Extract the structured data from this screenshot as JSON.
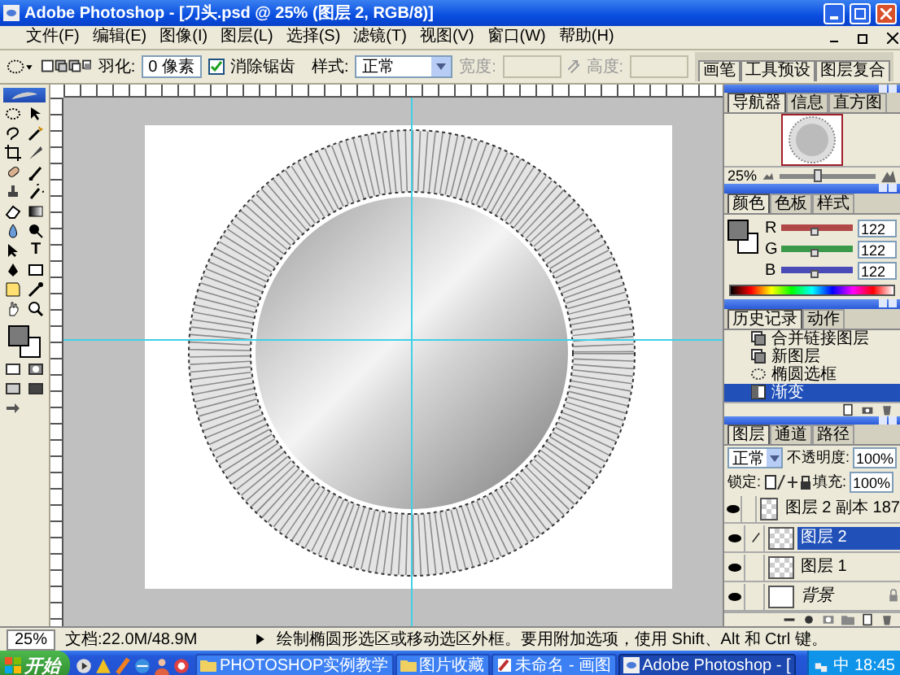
{
  "window": {
    "title": "Adobe Photoshop - [刀头.psd @ 25% (图层 2, RGB/8)]"
  },
  "menu": [
    "文件(F)",
    "编辑(E)",
    "图像(I)",
    "图层(L)",
    "选择(S)",
    "滤镜(T)",
    "视图(V)",
    "窗口(W)",
    "帮助(H)"
  ],
  "options_bar": {
    "feather_label": "羽化:",
    "feather_value": "0 像素",
    "antialias": {
      "label": "消除锯齿",
      "checked": true
    },
    "style_label": "样式:",
    "style_value": "正常",
    "width_label": "宽度:",
    "height_label": "高度:",
    "well_tabs": [
      "画笔",
      "工具预设",
      "图层复合"
    ]
  },
  "toolbox": {
    "type_tool_glyph": "T"
  },
  "navigator": {
    "tabs": [
      {
        "label": "导航器",
        "selected": true
      },
      {
        "label": "信息",
        "selected": false
      },
      {
        "label": "直方图",
        "selected": false
      }
    ],
    "zoom": "25%",
    "slider": {
      "level": 0.4
    }
  },
  "color": {
    "tabs": [
      {
        "label": "颜色",
        "selected": true
      },
      {
        "label": "色板",
        "selected": false
      },
      {
        "label": "样式",
        "selected": false
      }
    ],
    "channels": [
      {
        "name": "R",
        "value": "122",
        "level": 0.48,
        "color": "#b04848"
      },
      {
        "name": "G",
        "value": "122",
        "level": 0.48,
        "color": "#3a9a4a"
      },
      {
        "name": "B",
        "value": "122",
        "level": 0.48,
        "color": "#4a4ab8"
      }
    ]
  },
  "history": {
    "tabs": [
      {
        "label": "历史记录",
        "selected": true
      },
      {
        "label": "动作",
        "selected": false
      }
    ],
    "items": [
      {
        "label": "合并链接图层",
        "selected": false,
        "kind": "layers"
      },
      {
        "label": "新图层",
        "selected": false,
        "kind": "layers"
      },
      {
        "label": "椭圆选框",
        "selected": false,
        "kind": "ellipse"
      },
      {
        "label": "渐变",
        "selected": true,
        "kind": "gradient"
      }
    ]
  },
  "layers": {
    "tabs": [
      {
        "label": "图层",
        "selected": true
      },
      {
        "label": "通道",
        "selected": false
      },
      {
        "label": "路径",
        "selected": false
      }
    ],
    "blend_mode": "正常",
    "opacity_label": "不透明度:",
    "opacity": "100%",
    "lock_label": "锁定:",
    "fill_label": "填充:",
    "fill": "100%",
    "items": [
      {
        "name": "图层 2 副本 187",
        "selected": false,
        "visible": true,
        "kind": "layer"
      },
      {
        "name": "图层 2",
        "selected": true,
        "visible": true,
        "kind": "layer"
      },
      {
        "name": "图层 1",
        "selected": false,
        "visible": true,
        "kind": "layer"
      },
      {
        "name": "背景",
        "selected": false,
        "visible": true,
        "kind": "background"
      }
    ]
  },
  "status_bar": {
    "zoom": "25%",
    "doc_info": "文档:22.0M/48.9M",
    "hint": "绘制椭圆形选区或移动选区外框。要用附加选项，使用 Shift、Alt 和 Ctrl 键。"
  },
  "taskbar": {
    "start": "开始",
    "tasks": [
      {
        "label": "PHOTOSHOP实例教学",
        "selected": false,
        "kind": "folder"
      },
      {
        "label": "图片收藏",
        "selected": false,
        "kind": "folder"
      },
      {
        "label": "未命名 - 画图",
        "selected": false,
        "kind": "paint"
      },
      {
        "label": "Adobe Photoshop - [",
        "selected": true,
        "kind": "photoshop"
      }
    ],
    "ime": "中",
    "clock": "18:45"
  }
}
